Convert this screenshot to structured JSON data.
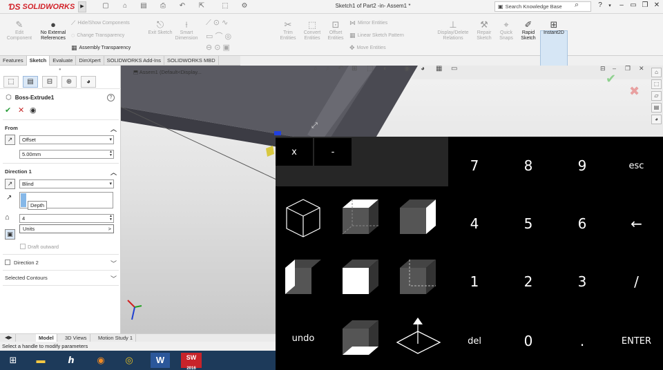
{
  "app": {
    "brand": "SOLIDWORKS",
    "window_title": "Sketch1 of Part2 -in- Assem1 *",
    "search_placeholder": "Search Knowledge Base",
    "help": "?"
  },
  "command_manager": {
    "tools": [
      {
        "label": "Edit Component",
        "icon": "edit-component-icon",
        "enabled": false
      },
      {
        "label": "No External References",
        "icon": "no-external-references-icon",
        "enabled": true
      },
      {
        "label": "Exit Sketch",
        "icon": "exit-sketch-icon",
        "enabled": false
      },
      {
        "label": "Smart Dimension",
        "icon": "smart-dimension-icon",
        "enabled": false
      },
      {
        "label": "Trim Entities",
        "icon": "trim-icon",
        "enabled": false
      },
      {
        "label": "Convert Entities",
        "icon": "convert-icon",
        "enabled": false
      },
      {
        "label": "Offset Entities",
        "icon": "offset-icon",
        "enabled": false
      },
      {
        "label": "Display/Delete Relations",
        "icon": "relations-icon",
        "enabled": false
      },
      {
        "label": "Repair Sketch",
        "icon": "repair-icon",
        "enabled": false
      },
      {
        "label": "Quick Snaps",
        "icon": "snaps-icon",
        "enabled": false
      },
      {
        "label": "Rapid Sketch",
        "icon": "rapid-sketch-icon",
        "enabled": true
      },
      {
        "label": "Instant2D",
        "icon": "instant2d-icon",
        "enabled": true
      }
    ],
    "small_tools": {
      "hide_show": "Hide/Show Components",
      "change_transparency": "Change Transparency",
      "assembly_transparency": "Assembly Transparency",
      "mirror": "Mirror Entities",
      "linear_pattern": "Linear Sketch Pattern",
      "move": "Move Entities"
    }
  },
  "tabs": [
    "Features",
    "Sketch",
    "Evaluate",
    "DimXpert",
    "SOLIDWORKS Add-Ins",
    "SOLIDWORKS MBD"
  ],
  "active_tab": "Sketch",
  "property_manager": {
    "feature_title": "Boss-Extrude1",
    "from": {
      "label": "From",
      "value": "Offset",
      "distance": "5.00mm"
    },
    "direction1": {
      "label": "Direction 1",
      "end_condition": "Blind",
      "depth_tooltip": "Depth",
      "depth_value": "4",
      "units_hint": "Units",
      "draft_outward": "Draft outward"
    },
    "direction2": {
      "label": "Direction 2"
    },
    "selected_contours": {
      "label": "Selected Contours"
    }
  },
  "graphics": {
    "tree_item": "Assem1 (Default<Display..."
  },
  "model_tabs": [
    "Model",
    "3D Views",
    "Motion Study 1"
  ],
  "active_model_tab": "Model",
  "status_text": "Select a handle to modify parameters",
  "taskbar": [
    {
      "name": "start-icon",
      "glyph": "⊞"
    },
    {
      "name": "file-explorer-icon",
      "glyph": "▬"
    },
    {
      "name": "hp-icon",
      "glyph": "ℎ"
    },
    {
      "name": "blender-icon",
      "glyph": "◉"
    },
    {
      "name": "chrome-icon",
      "glyph": "◎"
    },
    {
      "name": "word-icon",
      "glyph": "W"
    },
    {
      "name": "solidworks-icon",
      "glyph": "SW"
    }
  ],
  "taskbar_badge": "2016",
  "keypad": {
    "x": "x",
    "minus": "-",
    "digits": [
      "7",
      "8",
      "9",
      "4",
      "5",
      "6",
      "1",
      "2",
      "3",
      "0"
    ],
    "esc": "esc",
    "backspace": "←",
    "slash": "/",
    "undo": "undo",
    "del": "del",
    "dot": ".",
    "enter": "ENTER"
  },
  "colors": {
    "brand_red": "#d2232a",
    "keypad_bg": "#000000",
    "keypad_text": "#ffffff",
    "selection_blue": "#86b8e8"
  }
}
